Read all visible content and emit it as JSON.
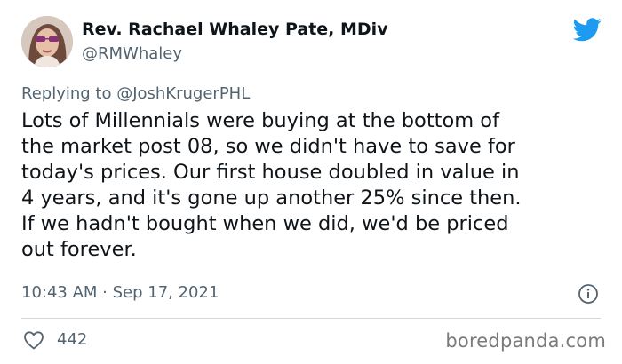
{
  "author": {
    "display_name": "Rev. Rachael Whaley Pate, MDiv",
    "handle": "@RMWhaley"
  },
  "reply": {
    "prefix": "Replying to ",
    "mention": "@JoshKrugerPHL"
  },
  "tweet": {
    "text": "Lots of Millennials were buying at the bottom of\nthe market post 08, so we didn't have to save for\ntoday's prices. Our first house doubled in value in\n4 years, and it's gone up another 25% since then.\nIf we hadn't bought when we did, we'd be priced\nout forever.",
    "timestamp": "10:43 AM · Sep 17, 2021"
  },
  "engagement": {
    "likes": "442"
  },
  "watermark": "boredpanda.com",
  "icons": {
    "brand": "twitter-bird-icon",
    "info": "info-icon",
    "like": "heart-icon"
  },
  "colors": {
    "brand_blue": "#1d9bf0",
    "text_primary": "#0f1419",
    "text_secondary": "#536471",
    "divider": "#cfd9de"
  }
}
